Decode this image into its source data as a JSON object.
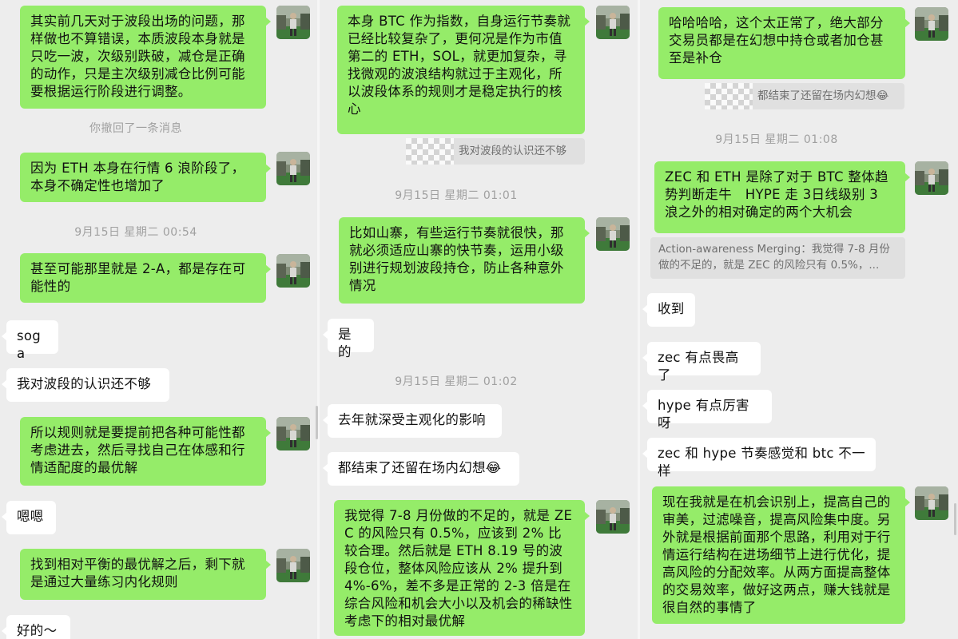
{
  "col1": {
    "msg1": "其实前几天对于波段出场的问题，那样做也不算错误，本质波段本身就是只吃一波，次级别跌破，减仓是正确的动作，只是主次级别减仓比例可能要根据运行阶段进行调整。",
    "notice_recall": "你撤回了一条消息",
    "msg2": "因为 ETH 本身在行情 6 浪阶段了，本身不确定性也增加了",
    "time1": "9月15日 星期二 00:54",
    "msg3": "甚至可能那里就是 2-A，都是存在可能性的",
    "reply_soga": "soga",
    "reply_not_enough": "我对波段的认识还不够",
    "msg4": "所以规则就是要提前把各种可能性都考虑进去，然后寻找自己在体感和行情适配度的最优解",
    "reply_enen": "嗯嗯",
    "msg5": "找到相对平衡的最优解之后，剩下就是通过大量练习内化规则",
    "reply_ok": "好的～"
  },
  "col2": {
    "msg1": "本身 BTC 作为指数，自身运行节奏就已经比较复杂了，更何况是作为市值第二的 ETH，SOL，就更加复杂，寻找微观的波浪结构就过于主观化，所以波段体系的规则才是稳定执行的核心",
    "quote1": "我对波段的认识还不够",
    "time1": "9月15日 星期二 01:01",
    "msg2": "比如山寨，有些运行节奏就很快，那就必须适应山寨的快节奏，运用小级别进行规划波段持仓，防止各种意外情况",
    "reply_yes": "是的",
    "time2": "9月15日 星期二 01:02",
    "reply_last_year": "去年就深受主观化的影响",
    "reply_fantasy": "都结束了还留在场内幻想😂",
    "msg3": "我觉得 7-8 月份做的不足的，就是 ZEC 的风险只有 0.5%，应该到 2% 比较合理。然后就是 ETH 8.19 号的波段仓位，整体风险应该从 2% 提升到 4%-6%，差不多是正常的 2-3 倍是在综合风险和机会大小以及机会的稀缺性考虑下的相对最优解"
  },
  "col3": {
    "msg1": "哈哈哈哈，这个太正常了，绝大部分交易员都是在幻想中持仓或者加仓甚至是补仓",
    "quote1": "都结束了还留在场内幻想😂",
    "time1": "9月15日 星期二 01:08",
    "msg2": "ZEC 和 ETH 是除了对于 BTC 整体趋势判断走牛　HYPE 走 3日线级别 3 浪之外的相对确定的两个大机会",
    "quote2": "Action-awareness Merging：我觉得 7-8 月份做的不足的，就是 ZEC 的风险只有 0.5%，...",
    "reply_received": "收到",
    "reply_zec": "zec 有点畏高了",
    "reply_hype": "hype 有点厉害呀",
    "reply_rhythm": "zec 和 hype 节奏感觉和 btc 不一样",
    "msg3": "现在我就是在机会识别上，提高自己的审美，过滤噪音，提高风险集中度。另外就是根据前面那个思路，利用对于行情运行结构在进场细节上进行优化，提高风险的分配效率。从两方面提高整体的交易效率，做好这两点，赚大钱就是很自然的事情了"
  },
  "colors": {
    "sent_bubble": "#95ec69",
    "received_bubble": "#ffffff",
    "background": "#ededed",
    "timestamp": "#a0a0a0"
  },
  "icons": {
    "avatar": "user-avatar-photo"
  }
}
